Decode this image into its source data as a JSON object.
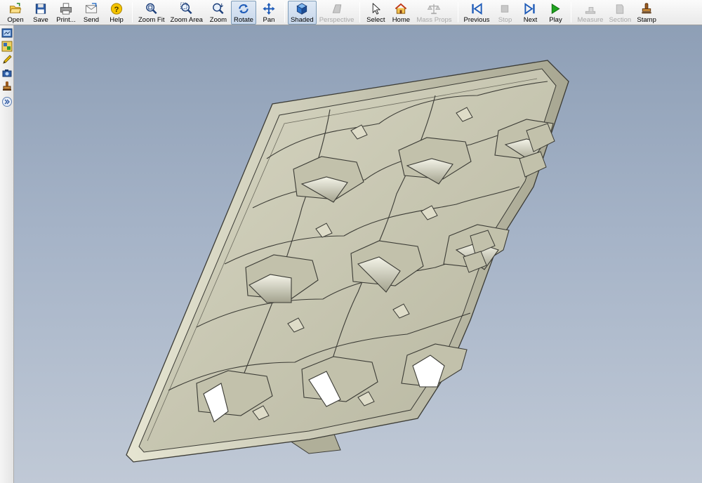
{
  "toolbar": {
    "open": "Open",
    "save": "Save",
    "print": "Print...",
    "send": "Send",
    "help": "Help",
    "zoom_fit": "Zoom Fit",
    "zoom_area": "Zoom Area",
    "zoom": "Zoom",
    "rotate": "Rotate",
    "pan": "Pan",
    "shaded": "Shaded",
    "perspective": "Perspective",
    "select": "Select",
    "home": "Home",
    "mass_props": "Mass Props",
    "previous": "Previous",
    "stop": "Stop",
    "next": "Next",
    "play": "Play",
    "measure": "Measure",
    "section": "Section",
    "stamp": "Stamp"
  },
  "state": {
    "active_tool": "Rotate",
    "display_mode": "Shaded"
  },
  "colors": {
    "viewport_top": "#8e9fb6",
    "viewport_bottom": "#c0c9d6",
    "model_face": "#c9c8b2",
    "model_edge": "#3b3b35"
  },
  "icons": {
    "left_toolbar": [
      "model-tree-icon",
      "configurations-icon",
      "markup-pencil-icon",
      "camera-view-icon",
      "stamp-tool-icon",
      "expand-chevrons-icon"
    ]
  }
}
